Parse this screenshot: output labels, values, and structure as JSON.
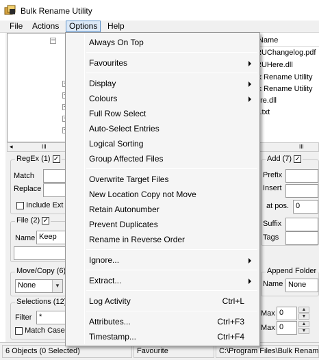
{
  "window": {
    "title": "Bulk Rename Utility"
  },
  "menubar": {
    "items": [
      "File",
      "Actions",
      "Options",
      "Help"
    ]
  },
  "tree": {
    "scroll_arrow": "◂",
    "scroll_grip": "III"
  },
  "file_list": {
    "header": "w Name",
    "items": [
      "RUChangelog.pdf",
      "RUHere.dll",
      "lk Rename Utility",
      "lk Rename Utility",
      "ere.dll",
      "s.txt"
    ],
    "scroll_grip": "III"
  },
  "panels": {
    "regex": {
      "title": "RegEx (1)",
      "match": "Match",
      "replace": "Replace",
      "include_ext": "Include Ext"
    },
    "file": {
      "title": "File (2)",
      "name": "Name",
      "name_value": "Keep"
    },
    "move_copy": {
      "title": "Move/Copy (6)",
      "value": "None"
    },
    "selections": {
      "title": "Selections (12)",
      "filter": "Filter",
      "filter_value": "*",
      "match_case": "Match Case"
    },
    "add": {
      "title": "Add (7)",
      "prefix": "Prefix",
      "insert": "Insert",
      "at_pos": "at pos.",
      "at_pos_value": "0",
      "suffix": "Suffix",
      "tags": "Tags"
    },
    "append_folder": {
      "title": "Append Folder",
      "name": "Name",
      "name_value": "None"
    },
    "numbering": {
      "max1": "Max",
      "max1_value": "0",
      "max2": "Max",
      "max2_value": "0"
    }
  },
  "status": {
    "objects": "6 Objects (0 Selected)",
    "favourite": "Favourite",
    "path": "C:\\Program Files\\Bulk Rename"
  },
  "options_menu": {
    "items": [
      {
        "label": "Always On Top"
      },
      {
        "separator": true
      },
      {
        "label": "Favourites",
        "submenu": true
      },
      {
        "separator": true
      },
      {
        "label": "Display",
        "submenu": true
      },
      {
        "label": "Colours",
        "submenu": true
      },
      {
        "label": "Full Row Select"
      },
      {
        "label": "Auto-Select Entries"
      },
      {
        "label": "Logical Sorting"
      },
      {
        "label": "Group Affected Files"
      },
      {
        "separator": true
      },
      {
        "label": "Overwrite Target Files"
      },
      {
        "label": "New Location Copy not Move"
      },
      {
        "label": "Retain Autonumber"
      },
      {
        "label": "Prevent Duplicates"
      },
      {
        "label": "Rename in Reverse Order"
      },
      {
        "separator": true
      },
      {
        "label": "Ignore...",
        "submenu": true
      },
      {
        "separator": true
      },
      {
        "label": "Extract...",
        "submenu": true
      },
      {
        "separator": true
      },
      {
        "label": "Log Activity",
        "shortcut": "Ctrl+L"
      },
      {
        "separator": true
      },
      {
        "label": "Attributes...",
        "shortcut": "Ctrl+F3"
      },
      {
        "label": "Timestamp...",
        "shortcut": "Ctrl+F4"
      }
    ]
  },
  "colors": {
    "menu_highlight": "#dce9f7",
    "menu_border": "#5a8fc7",
    "dialog_bg": "#f0f0f0"
  }
}
